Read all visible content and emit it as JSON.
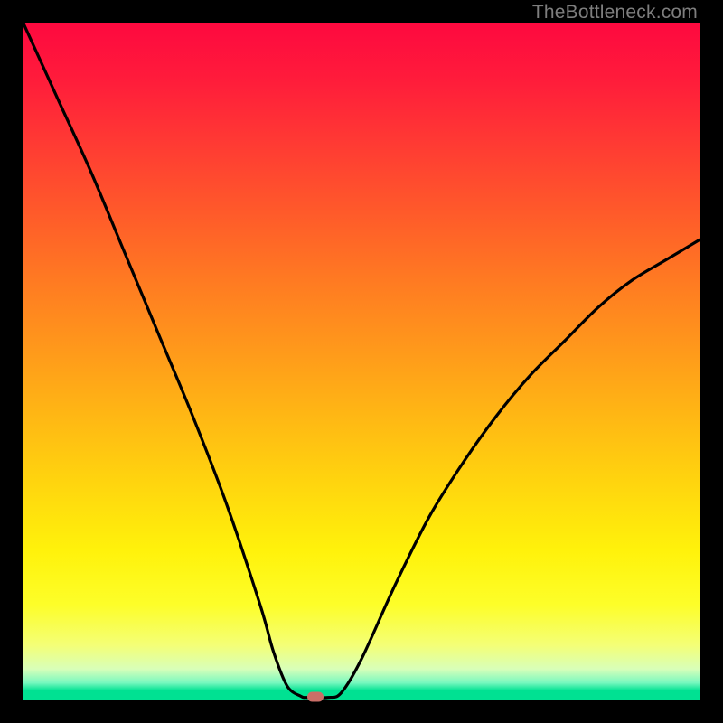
{
  "watermark": "TheBottleneck.com",
  "colors": {
    "frame": "#000000",
    "curve": "#000000",
    "marker": "#cb6e67",
    "gradient_top": "#fe093f",
    "gradient_bottom": "#00e192"
  },
  "chart_data": {
    "type": "line",
    "title": "",
    "xlabel": "",
    "ylabel": "",
    "xlim": [
      0,
      100
    ],
    "ylim": [
      0,
      100
    ],
    "grid": false,
    "series": [
      {
        "name": "bottleneck-curve",
        "x": [
          0,
          5,
          10,
          15,
          20,
          25,
          30,
          35,
          37,
          39,
          41,
          42,
          45,
          47,
          50,
          55,
          60,
          65,
          70,
          75,
          80,
          85,
          90,
          95,
          100
        ],
        "values": [
          100,
          89,
          78,
          66,
          54,
          42,
          29,
          14,
          7,
          2,
          0.5,
          0.3,
          0.3,
          1,
          6,
          17,
          27,
          35,
          42,
          48,
          53,
          58,
          62,
          65,
          68
        ]
      }
    ],
    "marker": {
      "x": 43.2,
      "y": 0.4
    },
    "annotations": []
  }
}
